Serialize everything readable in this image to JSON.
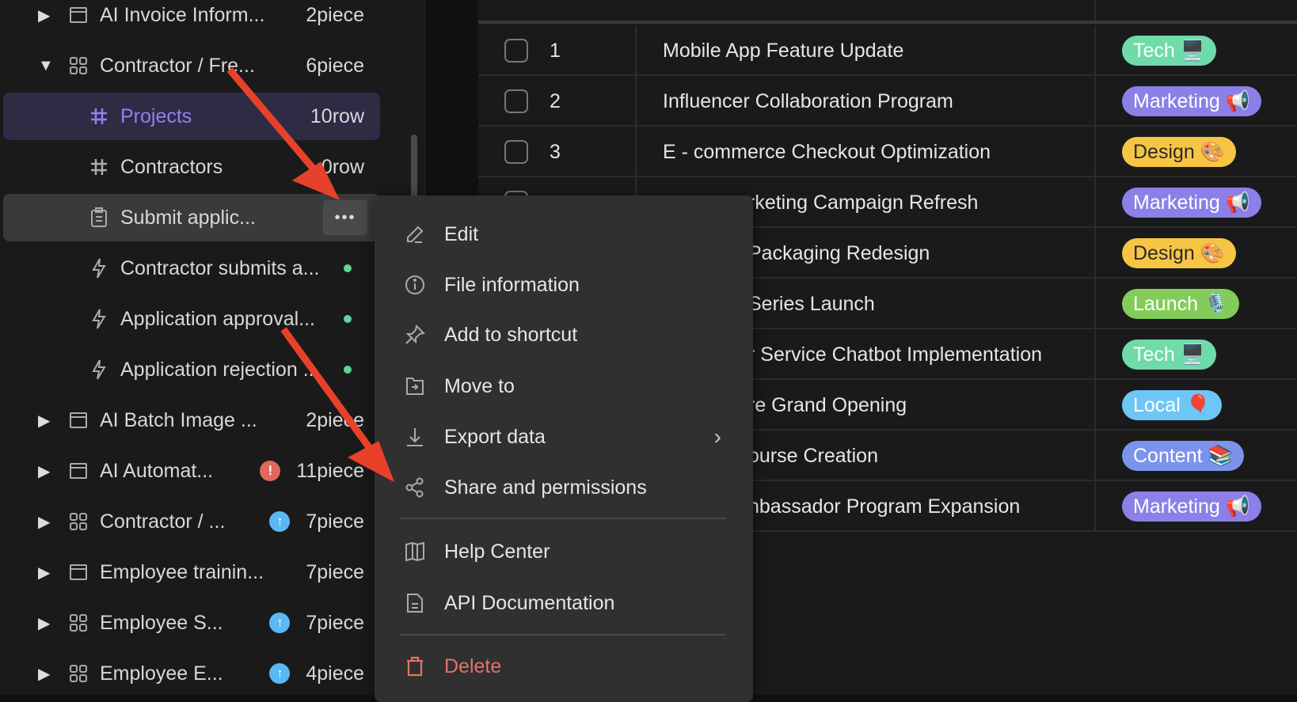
{
  "sidebar": {
    "items": [
      {
        "label": "AI Invoice Inform...",
        "count": "2piece",
        "icon": "folder-icon",
        "expander": "collapsed"
      },
      {
        "label": "Contractor / Fre...",
        "count": "6piece",
        "icon": "grid-icon",
        "expander": "expanded"
      },
      {
        "label": "Projects",
        "count": "10row",
        "icon": "hash-icon",
        "active": true
      },
      {
        "label": "Contractors",
        "count": "0row",
        "icon": "hash-icon"
      },
      {
        "label": "Submit applic...",
        "count": "",
        "icon": "form-icon",
        "more": "•••"
      },
      {
        "label": "Contractor submits a...",
        "icon": "lightning-icon",
        "status": "green-dot"
      },
      {
        "label": "Application approval...",
        "icon": "lightning-icon",
        "status": "green-dot"
      },
      {
        "label": "Application rejection ...",
        "icon": "lightning-icon",
        "status": "green-dot"
      },
      {
        "label": "AI Batch Image ...",
        "count": "2piece",
        "icon": "folder-icon",
        "expander": "collapsed"
      },
      {
        "label": "AI Automat...",
        "count": "11piece",
        "icon": "folder-icon",
        "badge": "!",
        "badge_color": "#e0685c"
      },
      {
        "label": "Contractor / ...",
        "count": "7piece",
        "icon": "grid-icon",
        "badge": "↑",
        "badge_color": "#5ab8f5"
      },
      {
        "label": "Employee trainin...",
        "count": "7piece",
        "icon": "folder-icon"
      },
      {
        "label": "Employee S...",
        "count": "7piece",
        "icon": "grid-icon",
        "badge": "↑",
        "badge_color": "#5ab8f5"
      },
      {
        "label": "Employee E...",
        "count": "4piece",
        "icon": "grid-icon",
        "badge": "↑",
        "badge_color": "#5ab8f5"
      }
    ]
  },
  "table": {
    "rows": [
      {
        "num": "1",
        "title": "Mobile App Feature Update",
        "tag": "Tech 🖥️",
        "color": "#6fdba8"
      },
      {
        "num": "2",
        "title": "Influencer Collaboration Program",
        "tag": "Marketing 📢",
        "color": "#8b7fe8"
      },
      {
        "num": "3",
        "title": "E - commerce Checkout Optimization",
        "tag": "Design 🎨",
        "color": "#f6c544",
        "dark": true
      },
      {
        "num": "",
        "title": "rketing Campaign Refresh",
        "tag": "Marketing 📢",
        "color": "#8b7fe8",
        "partial": true
      },
      {
        "num": "",
        "title": "Packaging Redesign",
        "tag": "Design 🎨",
        "color": "#f6c544",
        "dark": true,
        "partial": true
      },
      {
        "num": "",
        "title": "Series Launch",
        "tag": "Launch 🎙️",
        "color": "#84cc5a",
        "partial": true
      },
      {
        "num": "",
        "title": "r Service Chatbot Implementation",
        "tag": "Tech 🖥️",
        "color": "#6fdba8",
        "partial": true
      },
      {
        "num": "",
        "title": "re Grand Opening",
        "tag": "Local 🎈",
        "color": "#6ec6f5",
        "partial": true
      },
      {
        "num": "",
        "title": "ourse Creation",
        "tag": "Content 📚",
        "color": "#7b93ec",
        "partial": true
      },
      {
        "num": "",
        "title": "nbassador Program Expansion",
        "tag": "Marketing 📢",
        "color": "#8b7fe8",
        "partial": true
      }
    ]
  },
  "menu": {
    "items": [
      {
        "label": "Edit",
        "icon": "pencil-icon"
      },
      {
        "label": "File information",
        "icon": "info-icon"
      },
      {
        "label": "Add to shortcut",
        "icon": "pin-icon"
      },
      {
        "label": "Move to",
        "icon": "move-to-icon"
      },
      {
        "label": "Export data",
        "icon": "download-icon",
        "submenu": true
      },
      {
        "label": "Share and permissions",
        "icon": "share-icon"
      },
      {
        "label": "Help Center",
        "icon": "book-icon",
        "sep_before": true
      },
      {
        "label": "API Documentation",
        "icon": "document-icon"
      },
      {
        "label": "Delete",
        "icon": "trash-icon",
        "sep_before": true,
        "danger": true
      }
    ]
  },
  "colors": {
    "accent": "#8f82f0",
    "danger": "#e27466",
    "annotation_arrow": "#e8412a"
  }
}
